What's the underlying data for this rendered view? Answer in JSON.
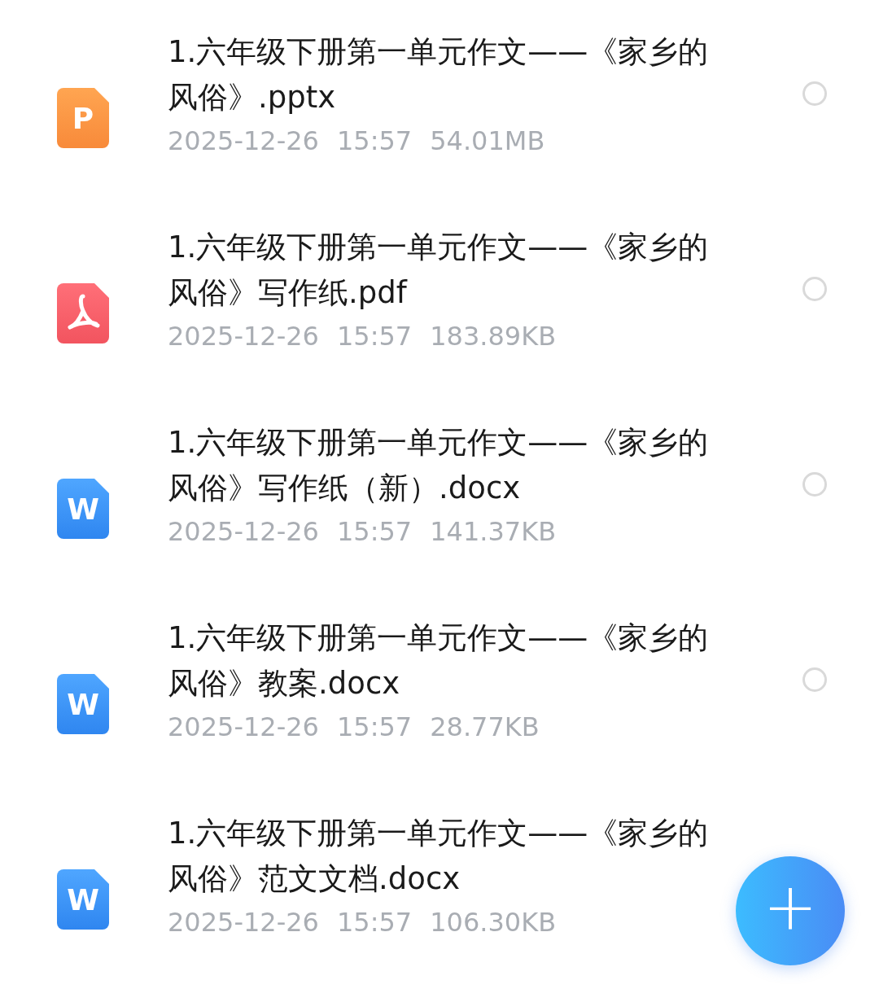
{
  "files": [
    {
      "kind": "ppt",
      "icon_text": "P",
      "title": "1.六年级下册第一单元作文——《家乡的风俗》.pptx",
      "date": "2025-12-26",
      "time": "15:57",
      "size": "54.01MB",
      "selected": false
    },
    {
      "kind": "pdf",
      "title": "1.六年级下册第一单元作文——《家乡的风俗》写作纸.pdf",
      "date": "2025-12-26",
      "time": "15:57",
      "size": "183.89KB",
      "selected": false
    },
    {
      "kind": "word",
      "icon_text": "W",
      "title": "1.六年级下册第一单元作文——《家乡的风俗》写作纸（新）.docx",
      "date": "2025-12-26",
      "time": "15:57",
      "size": "141.37KB",
      "selected": false
    },
    {
      "kind": "word",
      "icon_text": "W",
      "title": "1.六年级下册第一单元作文——《家乡的风俗》教案.docx",
      "date": "2025-12-26",
      "time": "15:57",
      "size": "28.77KB",
      "selected": false
    },
    {
      "kind": "word",
      "icon_text": "W",
      "title": "1.六年级下册第一单元作文——《家乡的风俗》范文文档.docx",
      "date": "2025-12-26",
      "time": "15:57",
      "size": "106.30KB"
    }
  ],
  "fab": {
    "label": "+"
  }
}
